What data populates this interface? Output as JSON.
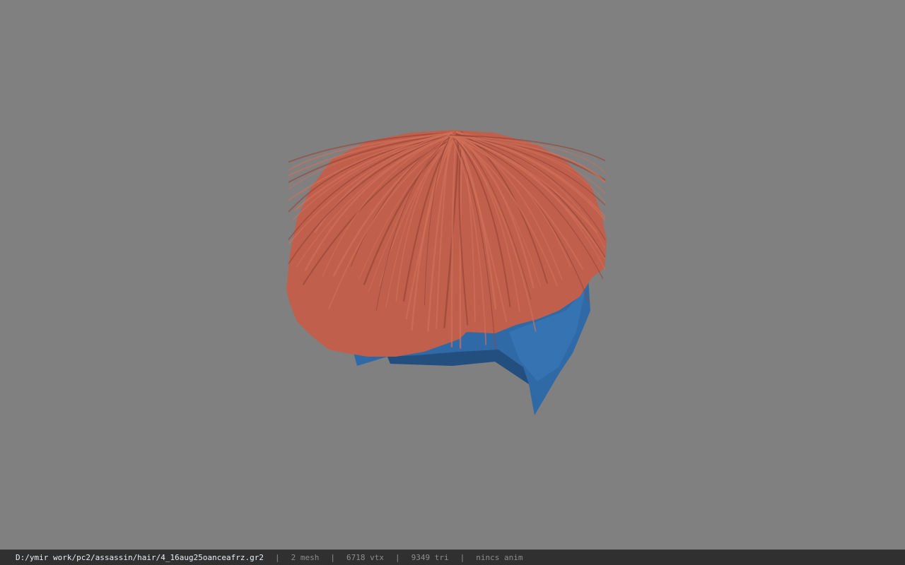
{
  "viewport": {
    "background_color": "#808080",
    "model": {
      "hair_color": "#c0604c",
      "hair_shade_color": "#9a4638",
      "cap_color": "#2f6aa6",
      "cap_shade_color": "#234f7e"
    }
  },
  "status_bar": {
    "file_path": "D:/ymir work/pc2/assassin/hair/4_16aug25oanceafrz.gr2",
    "separator": "|",
    "mesh_count": "2 mesh",
    "vertex_count": "6718 vtx",
    "triangle_count": "9349 tri",
    "animation": "nincs anim"
  }
}
